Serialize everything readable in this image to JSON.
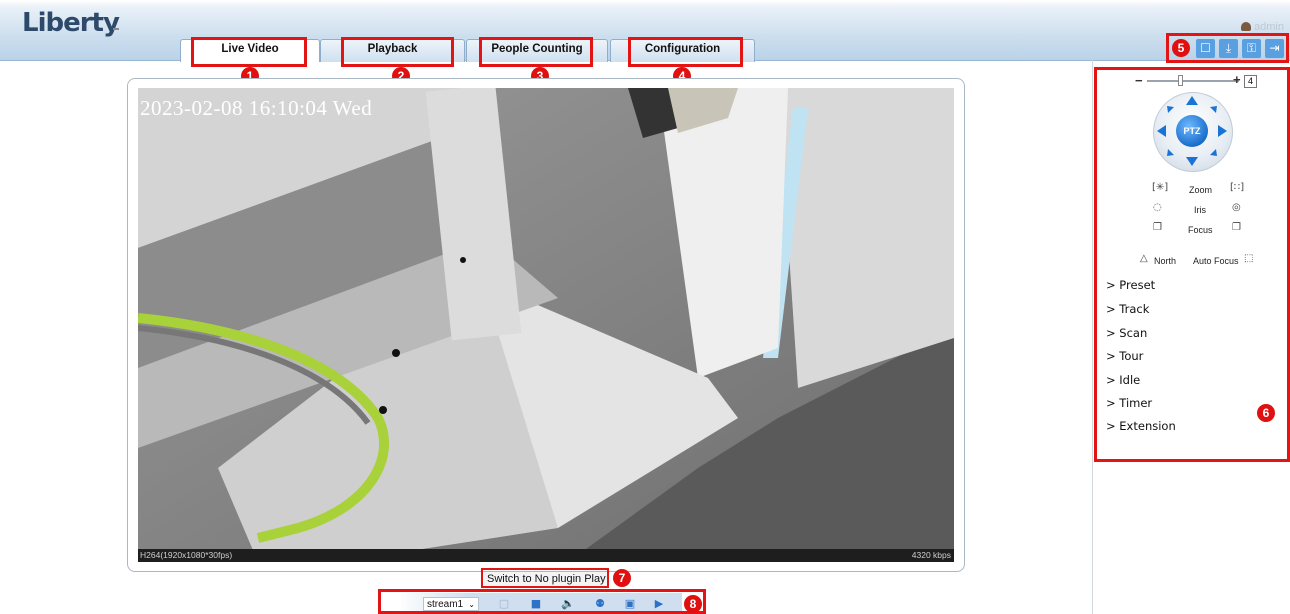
{
  "brand": {
    "logo": "Liberty"
  },
  "tabs": [
    {
      "label": "Live Video",
      "active": true
    },
    {
      "label": "Playback"
    },
    {
      "label": "People Counting"
    },
    {
      "label": "Configuration"
    }
  ],
  "user": {
    "name": "admin"
  },
  "toolbar_icons": [
    "snapshot-folder-icon",
    "download-icon",
    "lock-icon",
    "logout-icon"
  ],
  "callouts": [
    "1",
    "2",
    "3",
    "4",
    "5",
    "6",
    "7",
    "8"
  ],
  "video": {
    "osd_time": "2023-02-08 16:10:04 Wed",
    "codec_info": "H264(1920x1080*30fps)",
    "bitrate": "4320 kbps"
  },
  "switch_play": "Switch to No plugin Play",
  "bottom_toolbar": {
    "stream": "stream1",
    "icons": [
      "ratio-icon",
      "stop-icon",
      "mute-icon",
      "mic-icon",
      "camera-icon",
      "record-icon"
    ]
  },
  "ptz": {
    "speed": "4",
    "center_label": "PTZ",
    "zoom_label": "Zoom",
    "iris_label": "Iris",
    "focus_label": "Focus",
    "north_label": "North",
    "auto_focus_label": "Auto Focus",
    "menu": [
      "> Preset",
      "> Track",
      "> Scan",
      "> Tour",
      "> Idle",
      "> Timer",
      "> Extension"
    ]
  },
  "colors": {
    "callout": "#e31414",
    "accent": "#2d72c6"
  }
}
